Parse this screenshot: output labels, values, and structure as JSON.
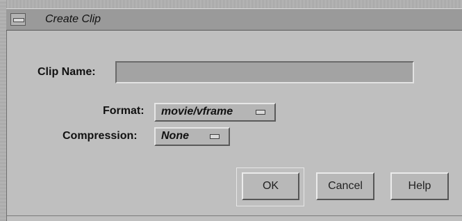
{
  "window": {
    "title": "Create Clip"
  },
  "form": {
    "clip_name_label": "Clip Name:",
    "clip_name_value": "",
    "format_label": "Format:",
    "format_value": "movie/vframe",
    "compression_label": "Compression:",
    "compression_value": "None"
  },
  "buttons": {
    "ok": "OK",
    "cancel": "Cancel",
    "help": "Help"
  },
  "icons": {
    "window_menu": "window-menu-icon",
    "option_indicator": "option-menu-indicator-icon"
  }
}
